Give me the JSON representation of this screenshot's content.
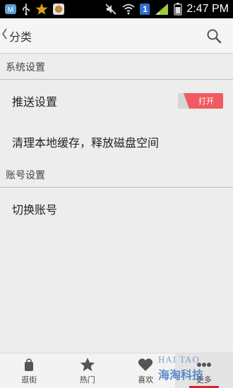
{
  "status_bar": {
    "time": "2:47 PM",
    "notification_badge": "1"
  },
  "header": {
    "title": "分类",
    "back_icon": "chevron-left-icon",
    "search_icon": "search-icon"
  },
  "sections": {
    "system": {
      "title": "系统设置",
      "push_label": "推送设置",
      "push_toggle_text": "打开",
      "push_enabled": true,
      "clear_cache_label": "清理本地缓存，释放磁盘空间"
    },
    "account": {
      "title": "账号设置",
      "switch_account_label": "切换账号"
    }
  },
  "bottom_nav": {
    "items": [
      {
        "label": "逛街",
        "icon": "bag-icon"
      },
      {
        "label": "热门",
        "icon": "star-icon"
      },
      {
        "label": "喜欢",
        "icon": "heart-icon"
      },
      {
        "label": "更多",
        "icon": "more-dots-icon"
      }
    ],
    "active_index": 3
  },
  "watermark": {
    "en": "HAI TAO",
    "cn": "海淘科技"
  },
  "colors": {
    "accent": "#f15a61",
    "active_bar": "#d9262e",
    "background": "#ededed"
  }
}
